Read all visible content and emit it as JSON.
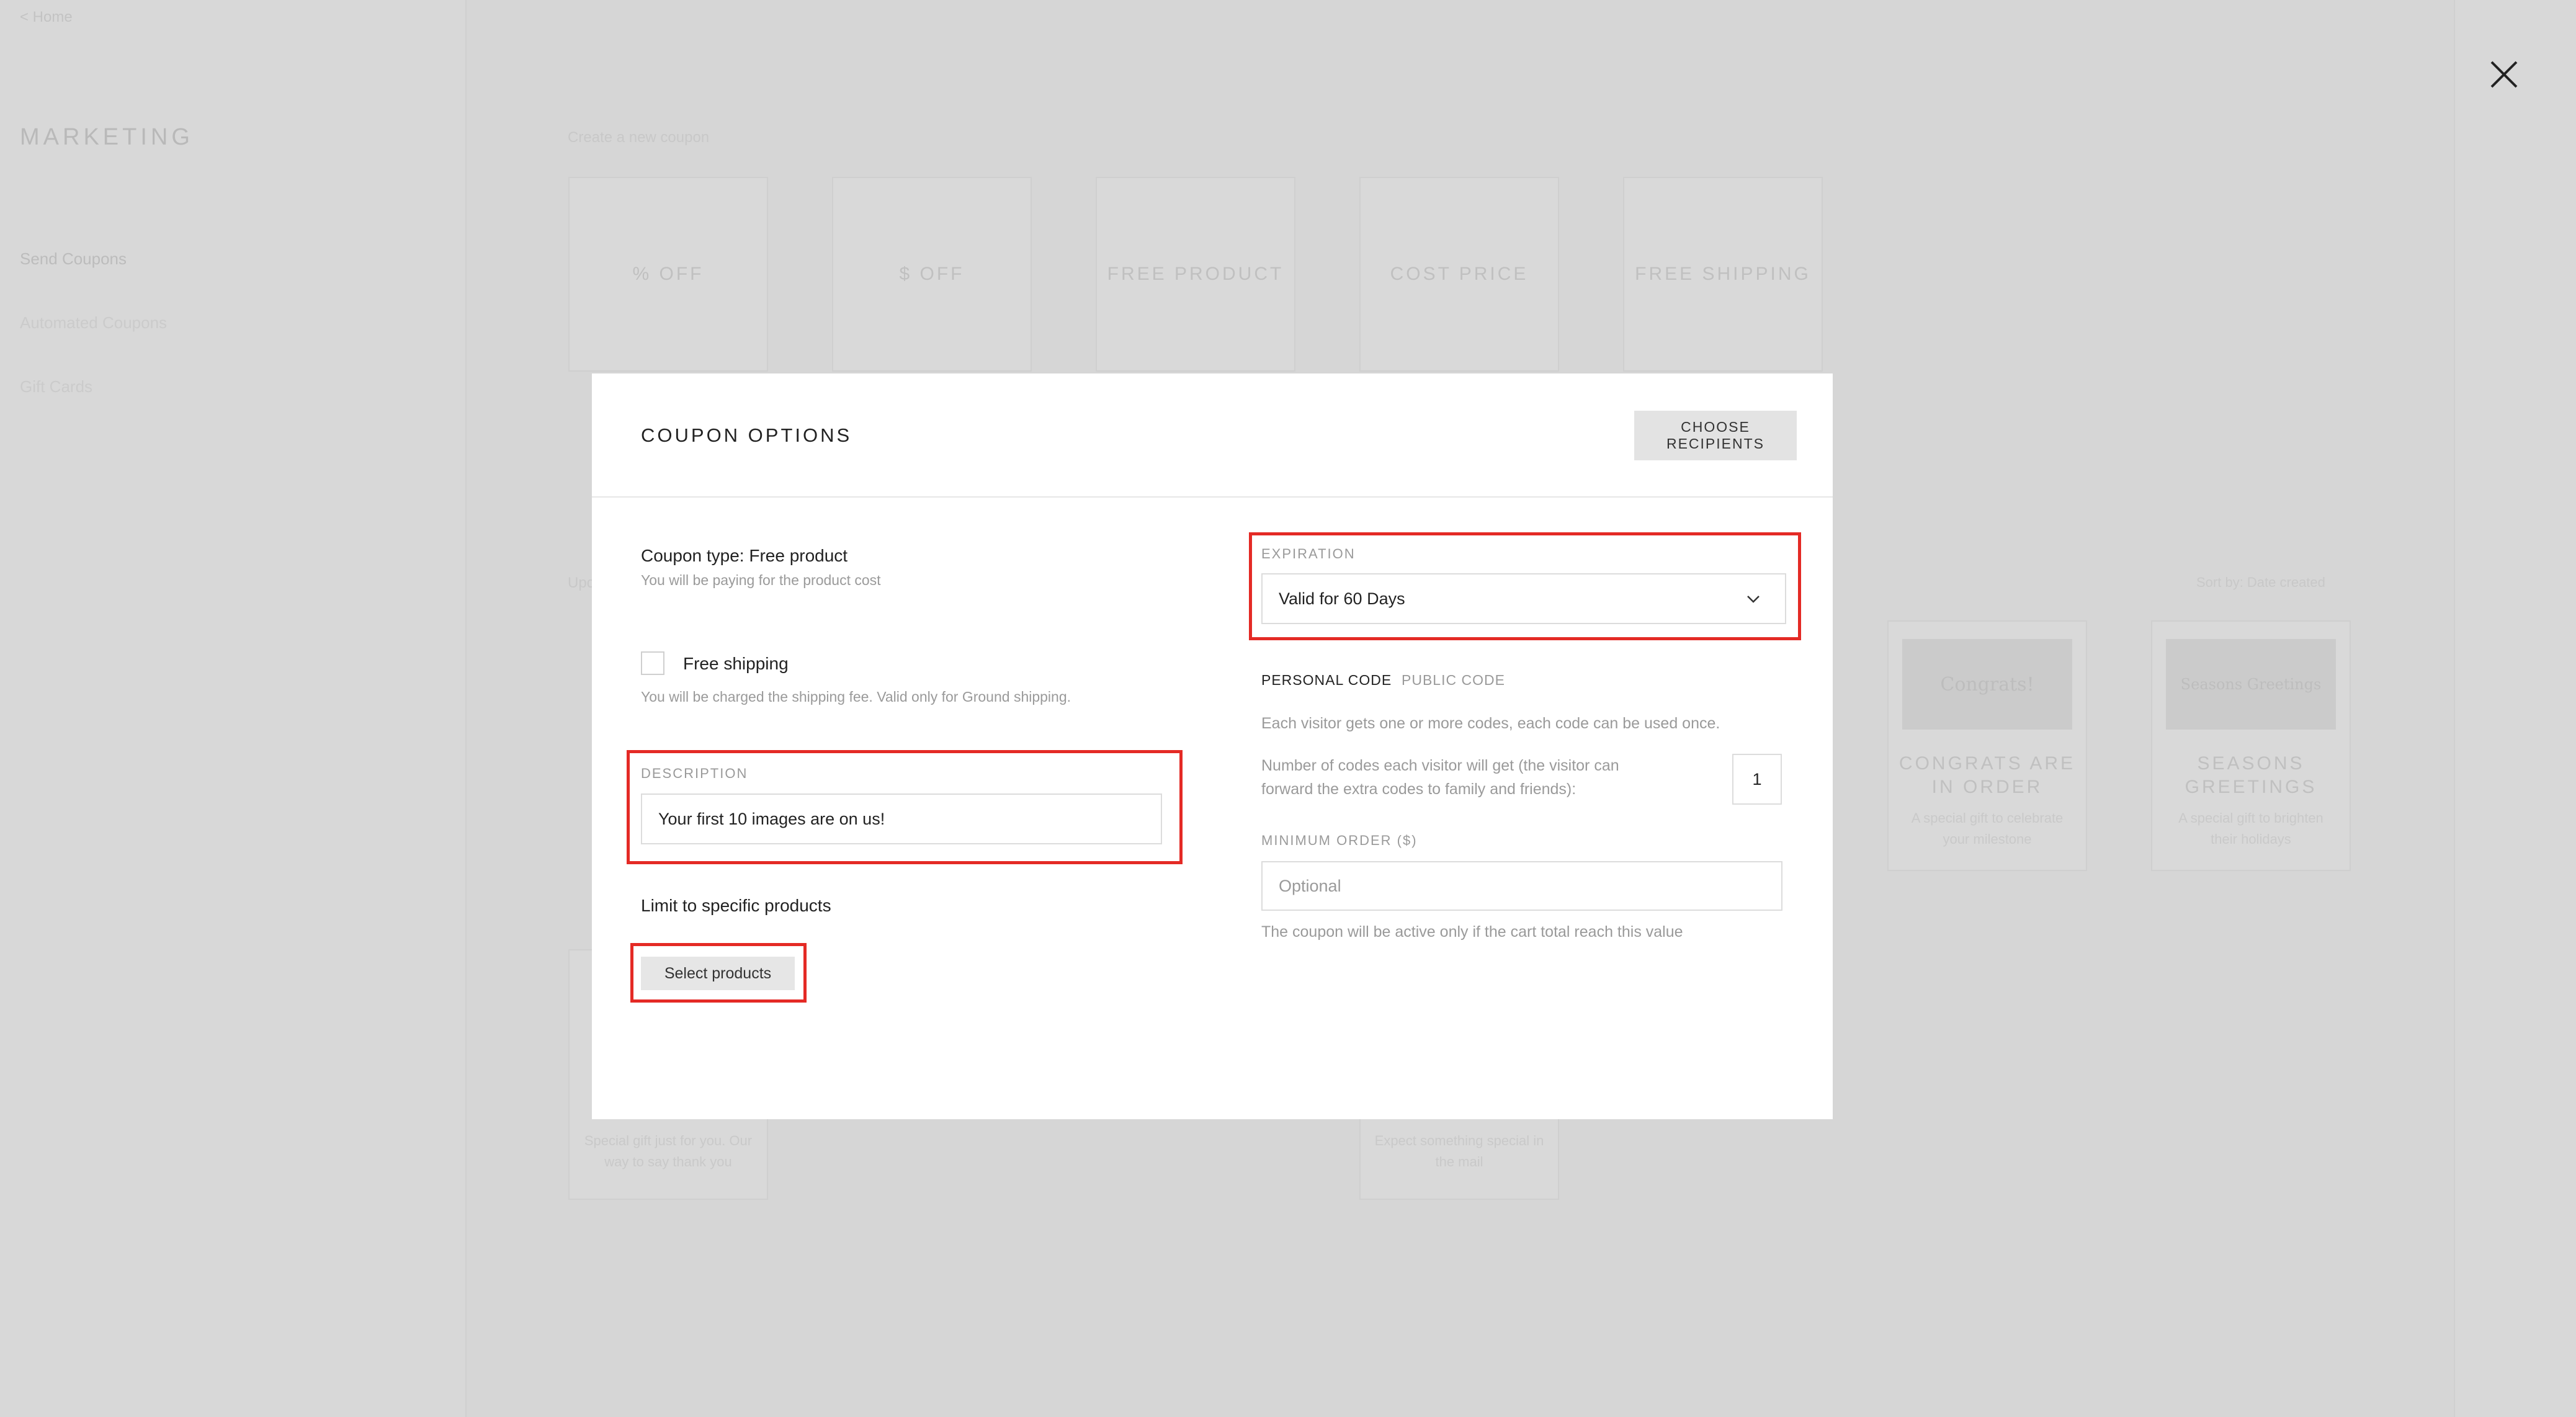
{
  "background": {
    "breadcrumb": "< Home",
    "sidebar_title": "MARKETING",
    "sidebar_items": [
      "Send Coupons",
      "Automated Coupons",
      "Gift Cards"
    ],
    "create_label": "Create a new coupon",
    "coupon_types": [
      "% OFF",
      "$ OFF",
      "FREE PRODUCT",
      "COST PRICE",
      "FREE SHIPPING"
    ],
    "sort_label": "Sort by: Date created",
    "section_label": "Upcoming",
    "templates": [
      {
        "image_text": "Congrats!",
        "title": "CONGRATS ARE IN ORDER",
        "subtitle": "A special gift to celebrate your milestone"
      },
      {
        "image_text": "Seasons Greetings",
        "title": "SEASONS GREETINGS",
        "subtitle": "A special gift to brighten their holidays"
      }
    ],
    "lower_texts": [
      "Special gift just for you. Our way to say thank you",
      "Expect something special in the mail"
    ]
  },
  "modal": {
    "title": "COUPON OPTIONS",
    "choose_recipients": "CHOOSE RECIPIENTS",
    "coupon_type_label": "Coupon type: Free product",
    "coupon_type_note": "You will be paying for the product cost",
    "free_shipping_label": "Free shipping",
    "free_shipping_checked": false,
    "free_shipping_note": "You will be charged the shipping fee. Valid only for Ground shipping.",
    "description_label": "DESCRIPTION",
    "description_value": "Your first 10 images are on us!",
    "limit_label": "Limit to specific products",
    "select_products": "Select products",
    "expiration_label": "EXPIRATION",
    "expiration_value": "Valid for 60 Days",
    "tabs": {
      "personal": "PERSONAL CODE",
      "public": "PUBLIC CODE",
      "active": "personal"
    },
    "code_note": "Each visitor gets one or more codes, each code can be used once.",
    "codes_count_label_line1": "Number of codes each visitor will get (the visitor can",
    "codes_count_label_line2": "forward the extra codes to family and friends):",
    "codes_count_value": "1",
    "min_order_label": "MINIMUM ORDER ($)",
    "min_order_placeholder": "Optional",
    "min_order_note": "The coupon will be active only if the cart total reach this value"
  },
  "colors": {
    "highlight": "#e42a25",
    "overlay": "#d6d6d6",
    "button_bg": "#e3e3e3"
  },
  "icons": {
    "close": "close-x-icon",
    "dropdown": "chevron-down-icon"
  }
}
